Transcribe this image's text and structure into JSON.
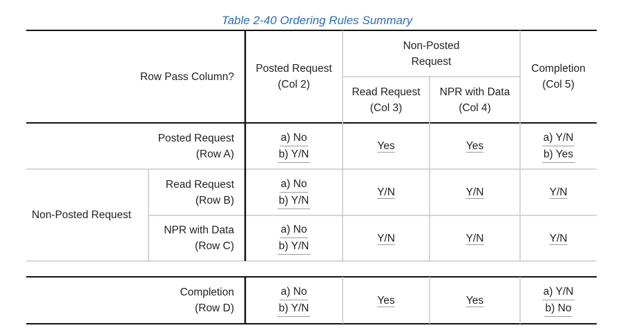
{
  "caption": "Table 2-40 Ordering Rules Summary",
  "header": {
    "corner": "Row Pass Column?",
    "col2": [
      "Posted Request",
      "(Col 2)"
    ],
    "np_group": [
      "Non-Posted",
      "Request"
    ],
    "col3": [
      "Read Request",
      "(Col 3)"
    ],
    "col4": [
      "NPR with Data",
      "(Col 4)"
    ],
    "col5": [
      "Completion",
      "(Col 5)"
    ]
  },
  "rows": {
    "a": {
      "label": [
        "Posted Request",
        "(Row A)"
      ],
      "c2": [
        "a) No",
        "b) Y/N"
      ],
      "c3": "Yes",
      "c4": "Yes",
      "c5": [
        "a) Y/N",
        "b) Yes"
      ]
    },
    "np_group_label": "Non-Posted Request",
    "b": {
      "label": [
        "Read Request",
        "(Row B)"
      ],
      "c2": [
        "a) No",
        "b) Y/N"
      ],
      "c3": "Y/N",
      "c4": "Y/N",
      "c5": "Y/N"
    },
    "c": {
      "label": [
        "NPR with Data",
        "(Row C)"
      ],
      "c2": [
        "a) No",
        "b) Y/N"
      ],
      "c3": "Y/N",
      "c4": "Y/N",
      "c5": "Y/N"
    },
    "d": {
      "label": [
        "Completion",
        "(Row D)"
      ],
      "c2": [
        "a) No",
        "b) Y/N"
      ],
      "c3": "Yes",
      "c4": "Yes",
      "c5": [
        "a) Y/N",
        "b) No"
      ]
    }
  }
}
